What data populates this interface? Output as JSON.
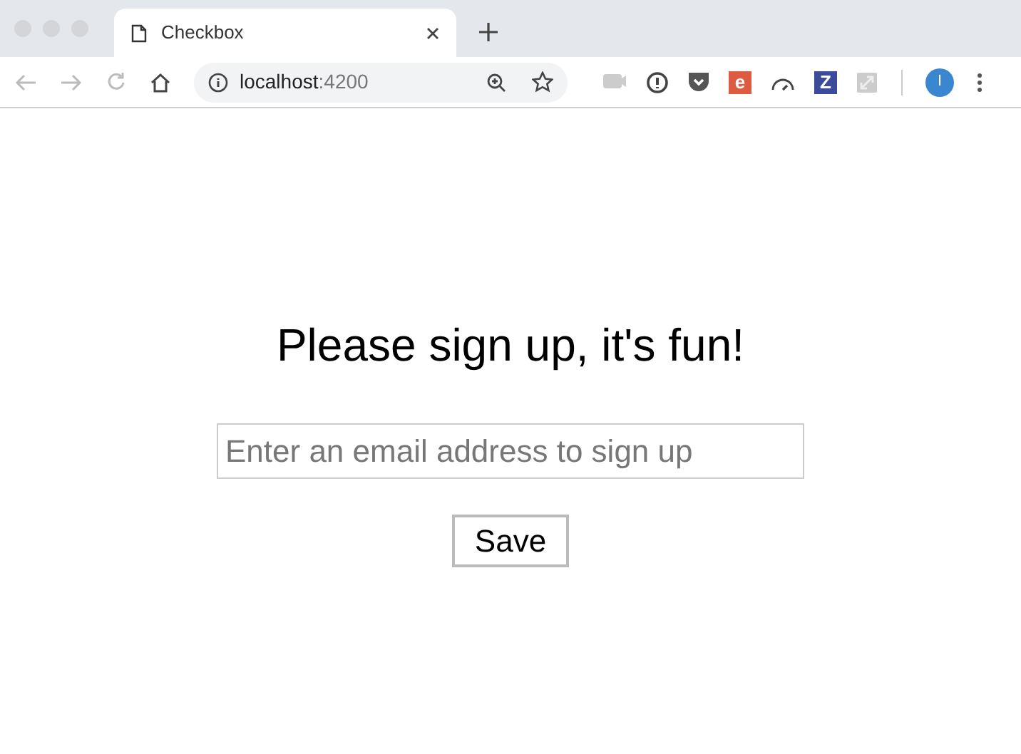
{
  "browser": {
    "tab": {
      "title": "Checkbox",
      "selected": true
    },
    "address": {
      "host": "localhost",
      "port": ":4200"
    },
    "extensions": [
      {
        "kind": "blank"
      },
      {
        "kind": "blank"
      },
      {
        "kind": "blank"
      },
      {
        "kind": "letter",
        "text": "e",
        "color": "#dd5b40"
      },
      {
        "kind": "blank"
      },
      {
        "kind": "letter",
        "text": "Z",
        "color": "#3b4a9a"
      },
      {
        "kind": "blank"
      }
    ],
    "profile": "I"
  },
  "page": {
    "heading": "Please sign up, it's fun!",
    "email": {
      "placeholder": "Enter an email address to sign up"
    },
    "button": "Save"
  }
}
